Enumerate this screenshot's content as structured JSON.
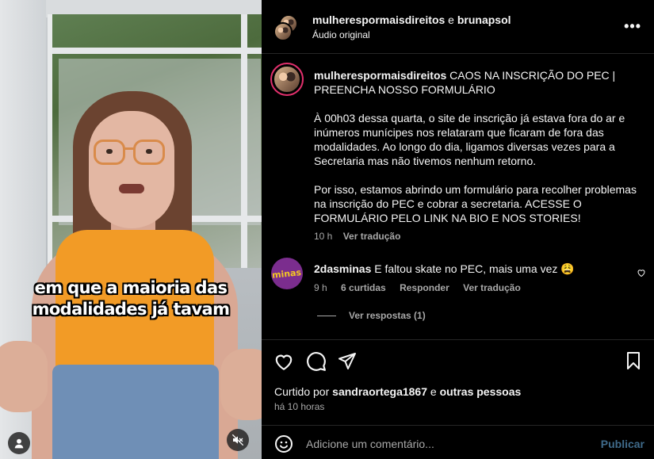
{
  "header": {
    "user1": "mulherespormaisdireitos",
    "separator": "e",
    "user2": "brunapsol",
    "audio": "Áudio original",
    "more_icon": "more-horizontal-icon"
  },
  "video": {
    "caption_line1": "em que a maioria das",
    "caption_line2": "modalidades já tavam",
    "user_icon": "user-tag-icon",
    "mute_icon": "speaker-muted-icon"
  },
  "caption": {
    "username": "mulherespormaisdireitos",
    "title": "CAOS NA INSCRIÇÃO DO PEC | PREENCHA NOSSO FORMULÁRIO",
    "para1": "À 00h03 dessa quarta, o site de inscrição já estava fora do ar e inúmeros munícipes nos relataram que ficaram de fora das modalidades. Ao longo do dia, ligamos diversas vezes para a Secretaria mas não tivemos nenhum retorno.",
    "para2": "Por isso, estamos abrindo um formulário para recolher problemas na inscrição do PEC e cobrar a secretaria. ACESSE O FORMULÁRIO PELO LINK NA BIO E NOS STORIES!",
    "time": "10 h",
    "translate": "Ver tradução"
  },
  "comment": {
    "username": "2dasminas",
    "avatar_text": "minas",
    "text": "E faltou skate no PEC, mais uma vez 😩",
    "time": "9 h",
    "likes": "6 curtidas",
    "reply": "Responder",
    "translate": "Ver tradução",
    "view_replies": "Ver respostas (1)"
  },
  "actions": {
    "liked_prefix": "Curtido por",
    "liked_user": "sandraortega1867",
    "liked_joiner": "e",
    "liked_others": "outras pessoas",
    "posted": "há 10 horas"
  },
  "add_comment": {
    "placeholder": "Adicione um comentário...",
    "publish": "Publicar"
  }
}
